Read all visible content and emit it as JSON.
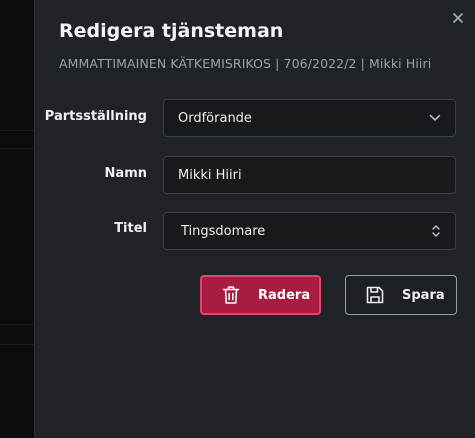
{
  "dialog": {
    "title": "Redigera tjänsteman",
    "subtitle": "AMMATTIMAINEN KÄTKEMISRIKOS | 706/2022/2 | Mikki Hiiri",
    "close_icon": "close-icon"
  },
  "form": {
    "role": {
      "label": "Partsställning",
      "value": "Ordförande",
      "icon": "chevron-down-icon"
    },
    "name": {
      "label": "Namn",
      "value": "Mikki Hiiri"
    },
    "title": {
      "label": "Titel",
      "value": "Tingsdomare",
      "icon": "chevron-up-down-icon"
    }
  },
  "actions": {
    "delete": {
      "label": "Radera",
      "icon": "trash-icon",
      "color": "#a81c3f"
    },
    "save": {
      "label": "Spara",
      "icon": "save-icon"
    }
  }
}
